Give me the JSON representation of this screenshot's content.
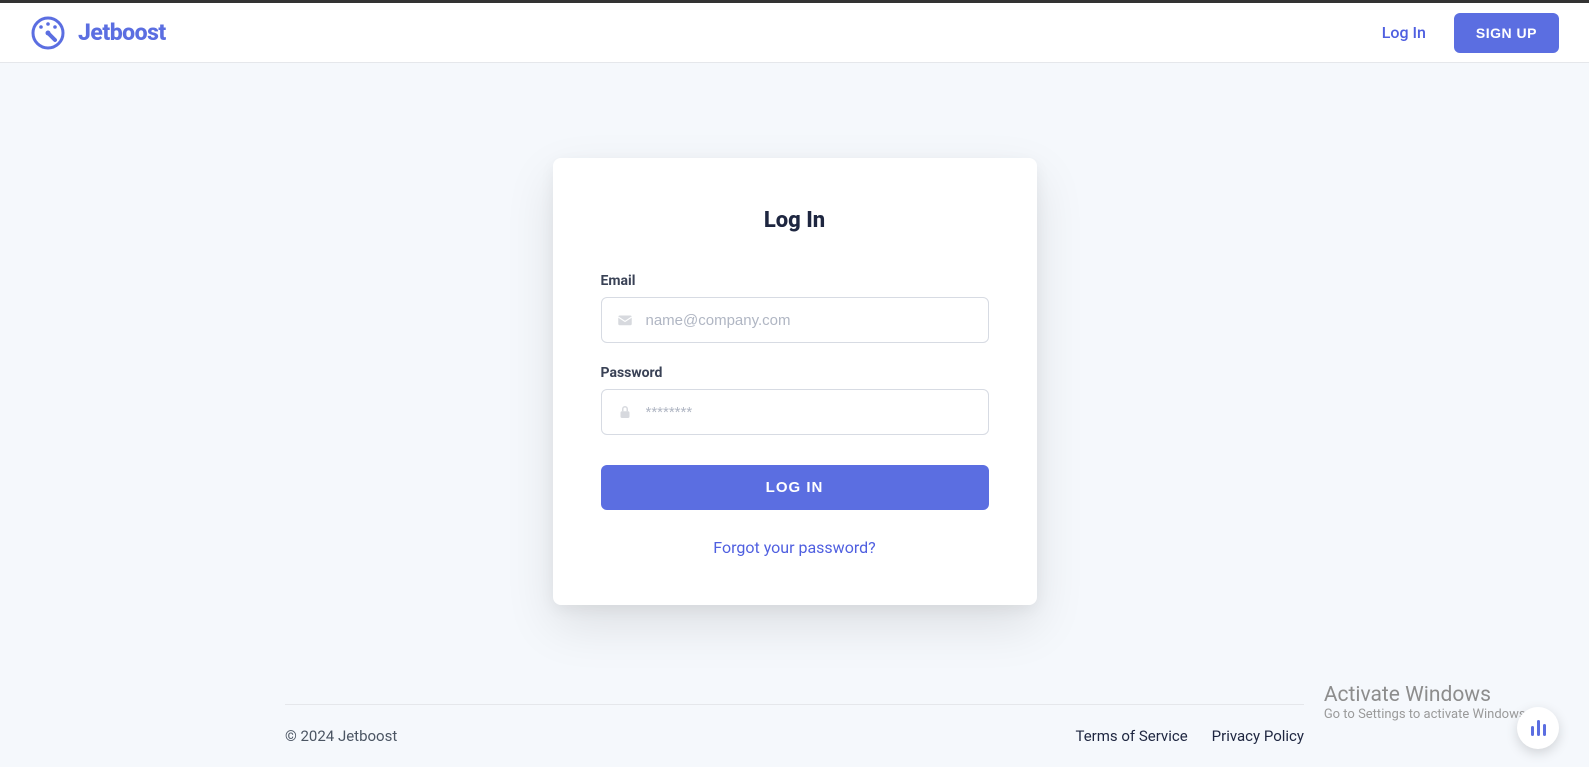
{
  "header": {
    "brand": "Jetboost",
    "login_link": "Log In",
    "signup_button": "SIGN UP"
  },
  "card": {
    "title": "Log In",
    "email_label": "Email",
    "email_placeholder": "name@company.com",
    "password_label": "Password",
    "password_placeholder": "********",
    "submit_button": "LOG IN",
    "forgot_link": "Forgot your password?"
  },
  "footer": {
    "copyright": "© 2024 Jetboost",
    "terms": "Terms of Service",
    "privacy": "Privacy Policy"
  },
  "watermark": {
    "title": "Activate Windows",
    "sub": "Go to Settings to activate Windows."
  }
}
